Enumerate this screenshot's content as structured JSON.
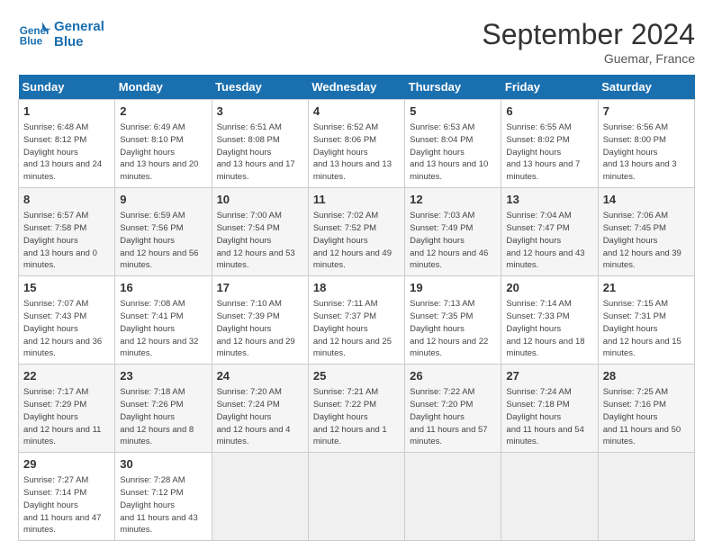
{
  "logo": {
    "line1": "General",
    "line2": "Blue"
  },
  "title": "September 2024",
  "location": "Guemar, France",
  "days_header": [
    "Sunday",
    "Monday",
    "Tuesday",
    "Wednesday",
    "Thursday",
    "Friday",
    "Saturday"
  ],
  "weeks": [
    [
      {
        "num": "1",
        "rise": "6:48 AM",
        "set": "8:12 PM",
        "daylight": "13 hours and 24 minutes."
      },
      {
        "num": "2",
        "rise": "6:49 AM",
        "set": "8:10 PM",
        "daylight": "13 hours and 20 minutes."
      },
      {
        "num": "3",
        "rise": "6:51 AM",
        "set": "8:08 PM",
        "daylight": "13 hours and 17 minutes."
      },
      {
        "num": "4",
        "rise": "6:52 AM",
        "set": "8:06 PM",
        "daylight": "13 hours and 13 minutes."
      },
      {
        "num": "5",
        "rise": "6:53 AM",
        "set": "8:04 PM",
        "daylight": "13 hours and 10 minutes."
      },
      {
        "num": "6",
        "rise": "6:55 AM",
        "set": "8:02 PM",
        "daylight": "13 hours and 7 minutes."
      },
      {
        "num": "7",
        "rise": "6:56 AM",
        "set": "8:00 PM",
        "daylight": "13 hours and 3 minutes."
      }
    ],
    [
      {
        "num": "8",
        "rise": "6:57 AM",
        "set": "7:58 PM",
        "daylight": "13 hours and 0 minutes."
      },
      {
        "num": "9",
        "rise": "6:59 AM",
        "set": "7:56 PM",
        "daylight": "12 hours and 56 minutes."
      },
      {
        "num": "10",
        "rise": "7:00 AM",
        "set": "7:54 PM",
        "daylight": "12 hours and 53 minutes."
      },
      {
        "num": "11",
        "rise": "7:02 AM",
        "set": "7:52 PM",
        "daylight": "12 hours and 49 minutes."
      },
      {
        "num": "12",
        "rise": "7:03 AM",
        "set": "7:49 PM",
        "daylight": "12 hours and 46 minutes."
      },
      {
        "num": "13",
        "rise": "7:04 AM",
        "set": "7:47 PM",
        "daylight": "12 hours and 43 minutes."
      },
      {
        "num": "14",
        "rise": "7:06 AM",
        "set": "7:45 PM",
        "daylight": "12 hours and 39 minutes."
      }
    ],
    [
      {
        "num": "15",
        "rise": "7:07 AM",
        "set": "7:43 PM",
        "daylight": "12 hours and 36 minutes."
      },
      {
        "num": "16",
        "rise": "7:08 AM",
        "set": "7:41 PM",
        "daylight": "12 hours and 32 minutes."
      },
      {
        "num": "17",
        "rise": "7:10 AM",
        "set": "7:39 PM",
        "daylight": "12 hours and 29 minutes."
      },
      {
        "num": "18",
        "rise": "7:11 AM",
        "set": "7:37 PM",
        "daylight": "12 hours and 25 minutes."
      },
      {
        "num": "19",
        "rise": "7:13 AM",
        "set": "7:35 PM",
        "daylight": "12 hours and 22 minutes."
      },
      {
        "num": "20",
        "rise": "7:14 AM",
        "set": "7:33 PM",
        "daylight": "12 hours and 18 minutes."
      },
      {
        "num": "21",
        "rise": "7:15 AM",
        "set": "7:31 PM",
        "daylight": "12 hours and 15 minutes."
      }
    ],
    [
      {
        "num": "22",
        "rise": "7:17 AM",
        "set": "7:29 PM",
        "daylight": "12 hours and 11 minutes."
      },
      {
        "num": "23",
        "rise": "7:18 AM",
        "set": "7:26 PM",
        "daylight": "12 hours and 8 minutes."
      },
      {
        "num": "24",
        "rise": "7:20 AM",
        "set": "7:24 PM",
        "daylight": "12 hours and 4 minutes."
      },
      {
        "num": "25",
        "rise": "7:21 AM",
        "set": "7:22 PM",
        "daylight": "12 hours and 1 minute."
      },
      {
        "num": "26",
        "rise": "7:22 AM",
        "set": "7:20 PM",
        "daylight": "11 hours and 57 minutes."
      },
      {
        "num": "27",
        "rise": "7:24 AM",
        "set": "7:18 PM",
        "daylight": "11 hours and 54 minutes."
      },
      {
        "num": "28",
        "rise": "7:25 AM",
        "set": "7:16 PM",
        "daylight": "11 hours and 50 minutes."
      }
    ],
    [
      {
        "num": "29",
        "rise": "7:27 AM",
        "set": "7:14 PM",
        "daylight": "11 hours and 47 minutes."
      },
      {
        "num": "30",
        "rise": "7:28 AM",
        "set": "7:12 PM",
        "daylight": "11 hours and 43 minutes."
      },
      null,
      null,
      null,
      null,
      null
    ]
  ]
}
